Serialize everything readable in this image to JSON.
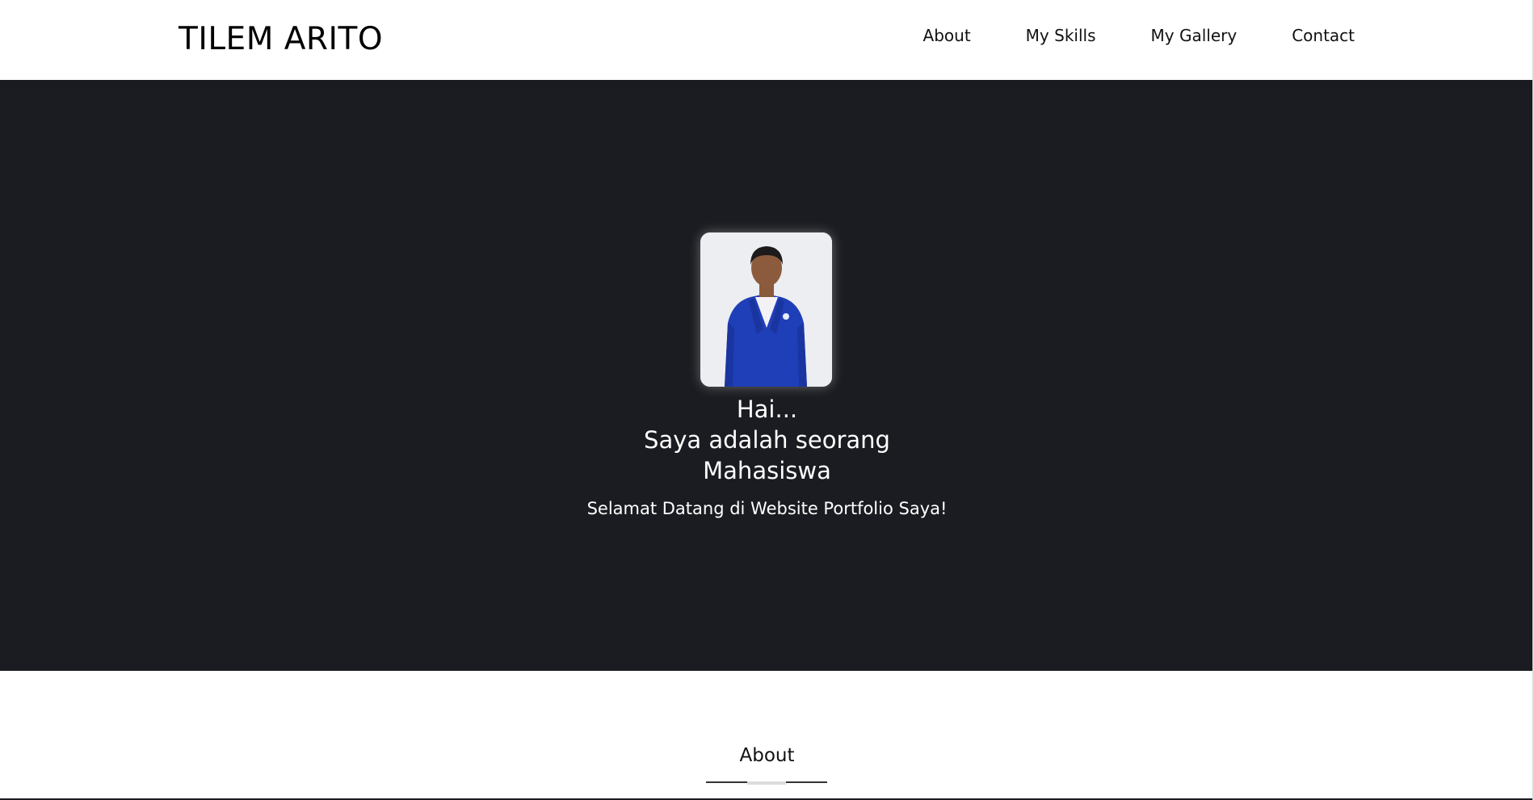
{
  "navbar": {
    "brand": "TILEM ARITO",
    "links": [
      {
        "label": "About"
      },
      {
        "label": "My Skills"
      },
      {
        "label": "My Gallery"
      },
      {
        "label": "Contact"
      }
    ]
  },
  "hero": {
    "photo_alt": "profile-photo",
    "greeting": "Hai...",
    "line2": "Saya adalah seorang",
    "line3": "Mahasiswa",
    "subtitle": "Selamat Datang di Website Portfolio Saya!"
  },
  "about": {
    "title": "About"
  },
  "colors": {
    "hero_background": "#1b1c21",
    "jacket_blue": "#1f3fb8",
    "text_light": "#ffffff",
    "text_dark": "#111111"
  }
}
